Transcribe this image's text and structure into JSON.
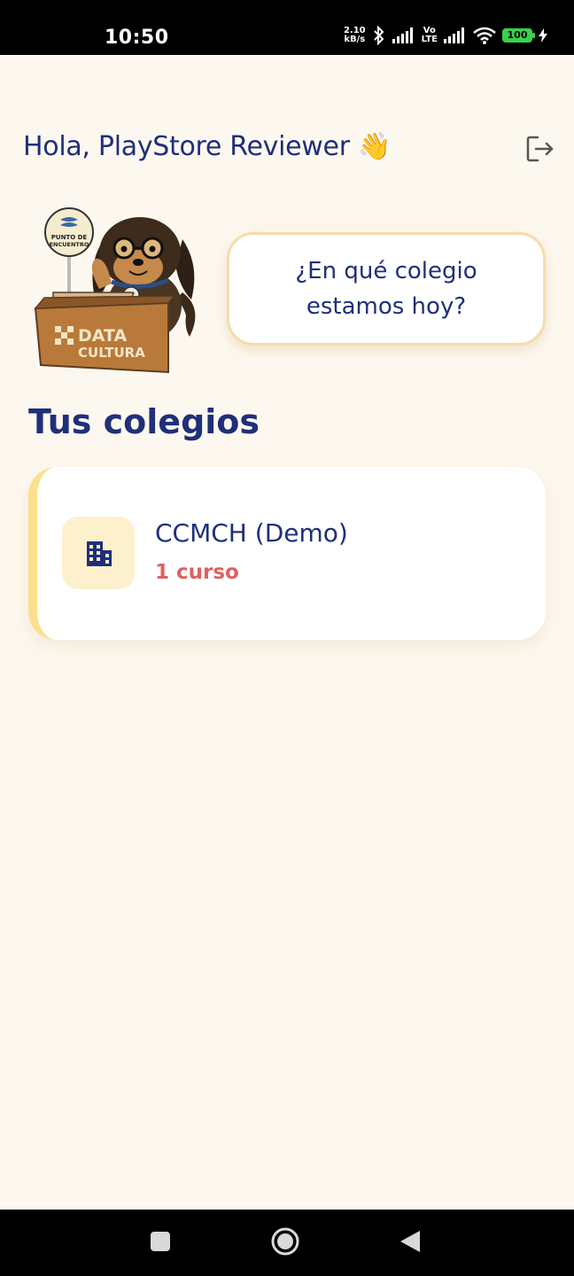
{
  "status_bar": {
    "time": "10:50",
    "net_speed_value": "2.10",
    "net_speed_unit": "kB/s",
    "vo_label": "Vo",
    "lte_label": "LTE",
    "battery": "100"
  },
  "header": {
    "greeting": "Hola, PlayStore Reviewer 👋"
  },
  "mascot": {
    "sign_text_line1": "PUNTO DE",
    "sign_text_line2": "ENCUENTRO",
    "desk_text_line1": "DATA",
    "desk_text_line2": "CULTURA"
  },
  "prompt": {
    "text": "¿En qué colegio estamos hoy?"
  },
  "section": {
    "title": "Tus colegios"
  },
  "schools": [
    {
      "name": "CCMCH (Demo)",
      "courses": "1 curso",
      "icon": "building-icon"
    }
  ],
  "colors": {
    "primary": "#1f2f7a",
    "accent": "#e06060",
    "background": "#fdf8ef",
    "card_border": "#fbe08d"
  }
}
